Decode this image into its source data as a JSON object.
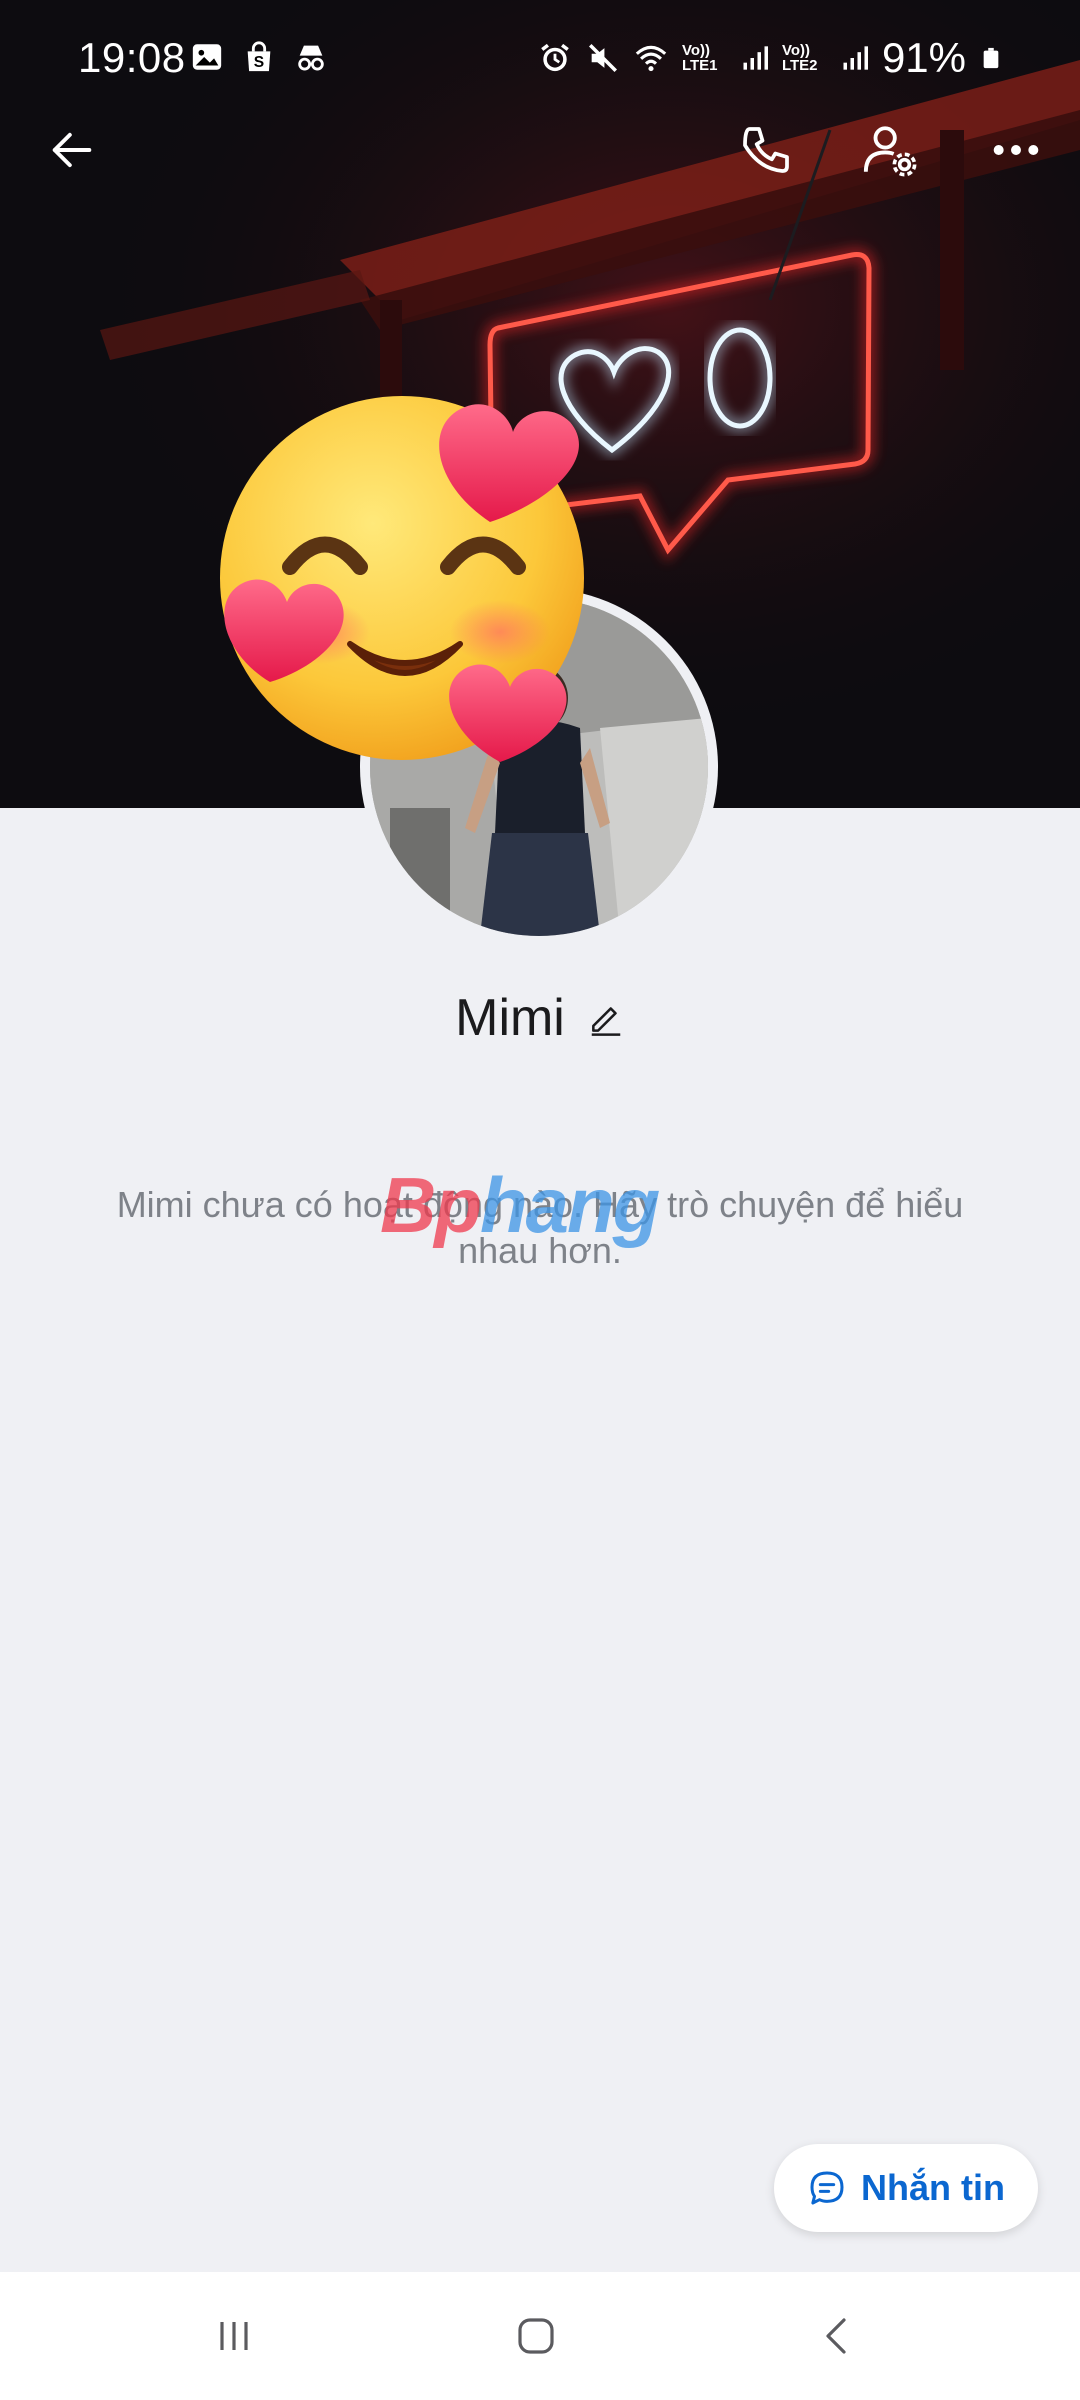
{
  "status_bar": {
    "time": "19:08",
    "battery": "91%",
    "sim1": "Vo)) LTE1",
    "sim2": "Vo)) LTE2",
    "left_icons": [
      "gallery-icon",
      "shopping-bag-icon",
      "incognito-icon"
    ],
    "right_icons": [
      "alarm-icon",
      "mute-icon",
      "wifi-icon",
      "signal-icon",
      "signal-icon",
      "battery-icon"
    ]
  },
  "topbar": {
    "icons": [
      "back-arrow-icon",
      "phone-icon",
      "user-settings-icon",
      "more-icon"
    ]
  },
  "profile": {
    "name": "Mimi",
    "empty_activity": "Mimi chưa có hoạt động nào. Hãy trò chuyện để hiểu nhau hơn."
  },
  "watermark": {
    "part1": "Bp",
    "part2": "hang"
  },
  "actions": {
    "message_label": "Nhắn tin"
  },
  "navbar": {
    "icons": [
      "recent-apps-icon",
      "home-icon",
      "back-icon"
    ]
  },
  "colors": {
    "accent": "#0b67d0",
    "background": "#eff0f4",
    "neon_red": "#ff2a2a",
    "neon_blue": "#dff2ff"
  }
}
